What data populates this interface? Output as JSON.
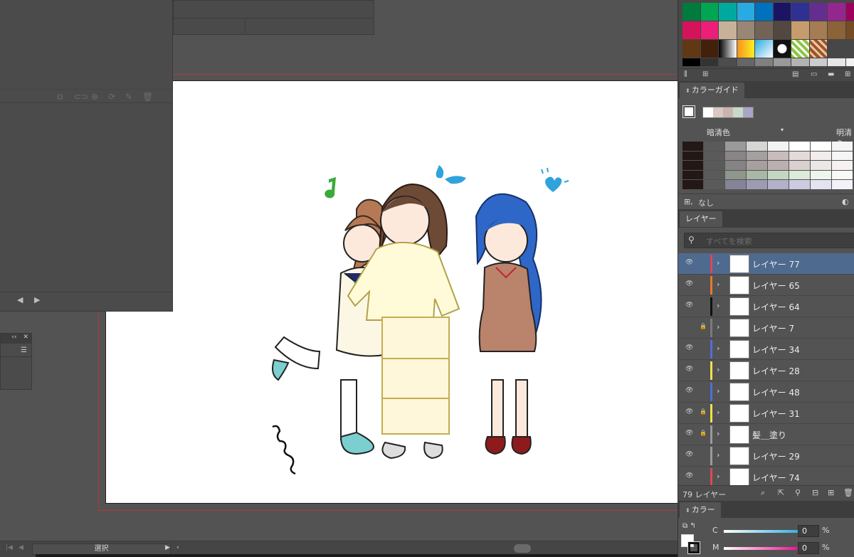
{
  "status_bar": {
    "mode_label": "選択"
  },
  "color_guide": {
    "tab_label": "カラーガイド",
    "dark_label": "暗清色",
    "light_label": "明清色",
    "footer_label": "なし",
    "harmony_colors": [
      "#ffffff",
      "#d9c8c6",
      "#c9b4b0",
      "#c8d9c7",
      "#a7a6c6"
    ],
    "grid_colors": [
      [
        "#231815",
        "#5a5a5a",
        "#9a9a9a",
        "#d6d6d6",
        "#f3f3f3",
        "#ffffff",
        "#ffffff",
        "#f5f5f5"
      ],
      [
        "#231815",
        "#5a5a5a",
        "#8a8585",
        "#a59f9f",
        "#c8bcbc",
        "#e3dada",
        "#f2ecec",
        "#f8f5f5"
      ],
      [
        "#231815",
        "#5a5a5a",
        "#858383",
        "#a89f9f",
        "#bcafb0",
        "#d9d0d0",
        "#ece7e7",
        "#f6f2f2"
      ],
      [
        "#231815",
        "#5a5a5a",
        "#8d978c",
        "#a9b8a6",
        "#c4d6c2",
        "#dcebd9",
        "#eef6ec",
        "#f7fbf6"
      ],
      [
        "#231815",
        "#5a5a5a",
        "#858397",
        "#9d9bb3",
        "#b3b1c9",
        "#cccbe0",
        "#e4e3f0",
        "#f2f2f8"
      ]
    ]
  },
  "layers_panel": {
    "tab_label": "レイヤー",
    "search_placeholder": "すべてを検索",
    "layers": [
      {
        "name": "レイヤー 77",
        "color": "#e0455a",
        "visible": true,
        "locked": false,
        "selected": true
      },
      {
        "name": "レイヤー 65",
        "color": "#e8782a",
        "visible": true,
        "locked": false,
        "selected": false
      },
      {
        "name": "レイヤー 64",
        "color": "#111111",
        "visible": true,
        "locked": false,
        "selected": false
      },
      {
        "name": "レイヤー 7",
        "color": "#7a7a7a",
        "visible": false,
        "locked": true,
        "selected": false
      },
      {
        "name": "レイヤー 34",
        "color": "#4f6fd8",
        "visible": true,
        "locked": false,
        "selected": false
      },
      {
        "name": "レイヤー 28",
        "color": "#f2e04a",
        "visible": true,
        "locked": false,
        "selected": false
      },
      {
        "name": "レイヤー 48",
        "color": "#4f6fd8",
        "visible": true,
        "locked": false,
        "selected": false
      },
      {
        "name": "レイヤー 31",
        "color": "#f2e04a",
        "visible": true,
        "locked": true,
        "selected": false
      },
      {
        "name": "髪＿塗り",
        "color": "#9a9a9a",
        "visible": true,
        "locked": true,
        "selected": false
      },
      {
        "name": "レイヤー 29",
        "color": "#9a9a9a",
        "visible": true,
        "locked": false,
        "selected": false
      },
      {
        "name": "レイヤー 74",
        "color": "#e0455a",
        "visible": true,
        "locked": false,
        "selected": false
      }
    ],
    "footer_count": "79 レイヤー"
  },
  "color_panel": {
    "tab_label": "カラー",
    "c_label": "C",
    "c_value": "0",
    "m_label": "M",
    "m_value": "0",
    "unit": "%"
  },
  "swatches": {
    "rows": [
      [
        "#007a3d",
        "#00a651",
        "#00a99d",
        "#29abe2",
        "#0071bc",
        "#1b1464",
        "#2e3192",
        "#662d91",
        "#93278f",
        "#9e005d"
      ],
      [
        "#d4145a",
        "#ed1e79",
        "#c7b299",
        "#998675",
        "#736357",
        "#534741",
        "#c69c6d",
        "#a67c52",
        "#8c6239",
        "#754c24"
      ],
      [
        "#603813",
        "#42210b",
        "#gradient-bw",
        "#gradient-yellow",
        "#gradient-blue",
        "#pattern-dots",
        "#pattern-green",
        "#pattern-brown"
      ]
    ],
    "small_row": [
      "#000000",
      "#333333",
      "#4d4d4d",
      "#666666",
      "#808080",
      "#999999",
      "#b3b3b3",
      "#cccccc",
      "#e6e6e6",
      "#f2f2f2"
    ]
  }
}
